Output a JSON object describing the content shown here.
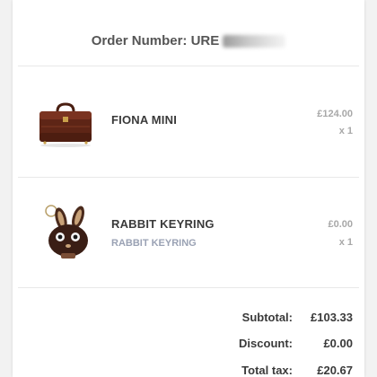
{
  "order": {
    "number_label": "Order Number: URE"
  },
  "items": [
    {
      "name": "FIONA MINI",
      "variant": "",
      "price": "£124.00",
      "quantity": "x 1",
      "image_icon": "brown-handbag-icon"
    },
    {
      "name": "RABBIT KEYRING",
      "variant": "RABBIT KEYRING",
      "price": "£0.00",
      "quantity": "x 1",
      "image_icon": "rabbit-keyring-icon"
    }
  ],
  "totals": {
    "subtotal_label": "Subtotal:",
    "subtotal_value": "£103.33",
    "discount_label": "Discount:",
    "discount_value": "£0.00",
    "tax_label": "Total tax:",
    "tax_value": "£20.67"
  },
  "colors": {
    "background": "#f2f2f2",
    "card": "#ffffff",
    "primary_text": "#3a3a3a",
    "muted_text": "#a8a8a8",
    "variant_text": "#9aa2b4",
    "divider": "#e8e8e8"
  }
}
